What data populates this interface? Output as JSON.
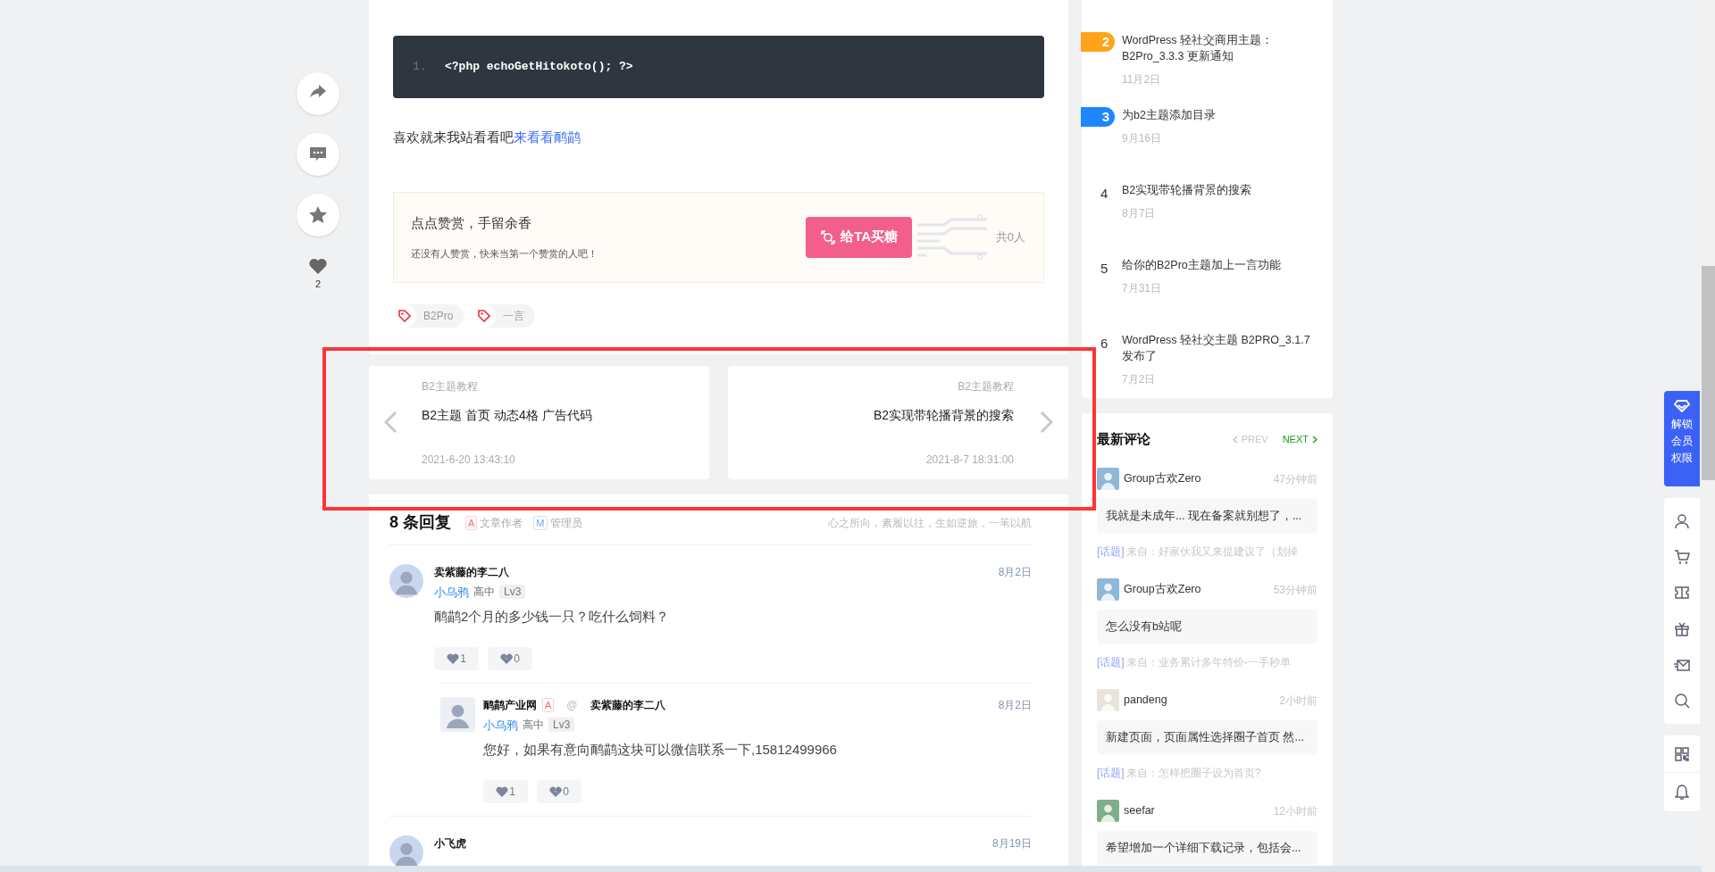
{
  "share_bar": {
    "like_count": "2"
  },
  "article": {
    "code_block": {
      "lines": [
        {
          "number": "1.",
          "code": "<?php echoGetHitokoto(); ?>"
        }
      ]
    },
    "paragraph": {
      "text": "喜欢就来我站看看吧",
      "link": "来看看鸸鹋"
    },
    "reward": {
      "title": "点点赞赏，手留余香",
      "subtitle": "还没有人赞赏，快来当第一个赞赏的人吧！",
      "button": "给TA买糖",
      "count": "共0人"
    },
    "tags": [
      "B2Pro",
      "一言"
    ]
  },
  "post_nav": [
    {
      "kind": "prev",
      "category": "B2主题教程",
      "title": "B2主题 首页 动态4格 广告代码",
      "date": "2021-6-20 13:43:10"
    },
    {
      "kind": "next",
      "category": "B2主题教程",
      "title": "B2实现带轮播背景的搜索",
      "date": "2021-8-7 18:31:00"
    }
  ],
  "comments": {
    "title": "8 条回复",
    "legend": [
      {
        "mark": "A",
        "label": "文章作者"
      },
      {
        "mark": "M",
        "label": "管理员"
      }
    ],
    "motto": "心之所向，素履以往，生如逆旅，一苇以航",
    "items": [
      {
        "name": "卖紫藤的李二八",
        "title": "小乌鸦",
        "grade": "高中",
        "level": "Lv3",
        "date": "8月2日",
        "text": "鸸鹋2个月的多少钱一只？吃什么饲料？",
        "likes": "1",
        "dislikes": "0",
        "replies": [
          {
            "name": "鸸鹋产业网",
            "badge": "A",
            "at": "@",
            "reply_to": "卖紫藤的李二八",
            "title": "小乌鸦",
            "grade": "高中",
            "level": "Lv3",
            "date": "8月2日",
            "text": "您好，如果有意向鸸鹋这块可以微信联系一下,15812499966",
            "likes": "1",
            "dislikes": "0"
          }
        ]
      },
      {
        "name": "小飞虎",
        "date": "8月19日"
      }
    ]
  },
  "sidebar": {
    "hot_posts": [
      {
        "kind": "badge",
        "color": "#ffa31a",
        "rank": "2",
        "title": "WordPress 轻社交商用主题：B2Pro_3.3.3 更新通知",
        "date": "11月2日"
      },
      {
        "kind": "badge",
        "color": "#1f86ff",
        "rank": "3",
        "title": "为b2主题添加目录",
        "date": "9月16日"
      },
      {
        "kind": "plain",
        "rank": "4",
        "title": "B2实现带轮播背景的搜索",
        "date": "8月7日"
      },
      {
        "kind": "plain",
        "rank": "5",
        "title": "给你的B2Pro主题加上一言功能",
        "date": "7月31日"
      },
      {
        "kind": "plain",
        "rank": "6",
        "title": "WordPress 轻社交主题 B2PRO_3.1.7 发布了",
        "date": "7月2日"
      }
    ],
    "latest_comments": {
      "title": "最新评论",
      "prev": {
        "label": "PREV",
        "disabled": true
      },
      "next": {
        "label": "NEXT",
        "disabled": false
      },
      "items": [
        {
          "user": "Group古欢Zero",
          "time": "47分钟前",
          "text": "我就是未成年... 现在备案就别想了，...",
          "topic": "[话题]",
          "source": "来自：好家伙我又来提建议了（划掉"
        },
        {
          "user": "Group古欢Zero",
          "time": "53分钟前",
          "text": "怎么没有b站呢",
          "topic": "[话题]",
          "source": "来自：业务累计多年特价-一手秒单"
        },
        {
          "user": "pandeng",
          "time": "2小时前",
          "text": "新建页面，页面属性选择圈子首页 然...",
          "topic": "[话题]",
          "source": "来自：怎样把圈子设为首页?"
        },
        {
          "user": "seefar",
          "time": "12小时前",
          "text": "希望增加一个详细下载记录，包括会..."
        }
      ]
    }
  },
  "float_toolbar": {
    "vip": "解锁会员权限"
  }
}
